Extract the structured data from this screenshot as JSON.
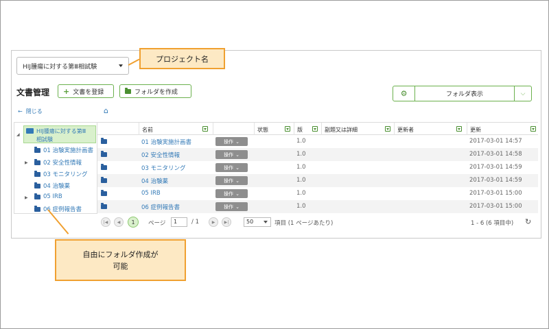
{
  "project_select": {
    "value": "HIJ腫瘍に対する第Ⅲ相試験"
  },
  "callouts": {
    "project": "プロジェクト名",
    "folder_line1": "自由にフォルダ作成が",
    "folder_line2": "可能"
  },
  "header": {
    "title": "文書管理",
    "add_doc_label": "文書を登録",
    "create_folder_label": "フォルダを作成"
  },
  "view_toggle": {
    "label": "フォルダ表示",
    "gear_icon": "gear-icon",
    "caret": "chevron-down-icon"
  },
  "close_link": {
    "label": "閉じる"
  },
  "tree": {
    "root_line1": "HIJ腫瘍に対する第Ⅲ",
    "root_line2": "相試験",
    "items": [
      {
        "label": "01 治験実施計画書"
      },
      {
        "label": "02 安全性情報"
      },
      {
        "label": "03 モニタリング"
      },
      {
        "label": "04 治験薬"
      },
      {
        "label": "05 IRB"
      },
      {
        "label": "06 症例報告書"
      }
    ]
  },
  "grid": {
    "columns": [
      "名前",
      "状態",
      "版",
      "副題又は詳細",
      "更新者",
      "更新"
    ],
    "action_label": "操作",
    "rows": [
      {
        "name": "01 治験実施計画書",
        "version": "1.0",
        "updated": "2017-03-01 14:57"
      },
      {
        "name": "02 安全性情報",
        "version": "1.0",
        "updated": "2017-03-01 14:58"
      },
      {
        "name": "03 モニタリング",
        "version": "1.0",
        "updated": "2017-03-01 14:59"
      },
      {
        "name": "04 治験薬",
        "version": "1.0",
        "updated": "2017-03-01 14:59"
      },
      {
        "name": "05 IRB",
        "version": "1.0",
        "updated": "2017-03-01 15:00"
      },
      {
        "name": "06 症例報告書",
        "version": "1.0",
        "updated": "2017-03-01 15:00"
      }
    ]
  },
  "pager": {
    "current": "1",
    "page_label": "ページ",
    "page_value": "1",
    "page_total": "/ 1",
    "page_size": "50",
    "items_label": "項目 (1 ページあたり)",
    "summary": "1 - 6 (6 項目中)"
  }
}
